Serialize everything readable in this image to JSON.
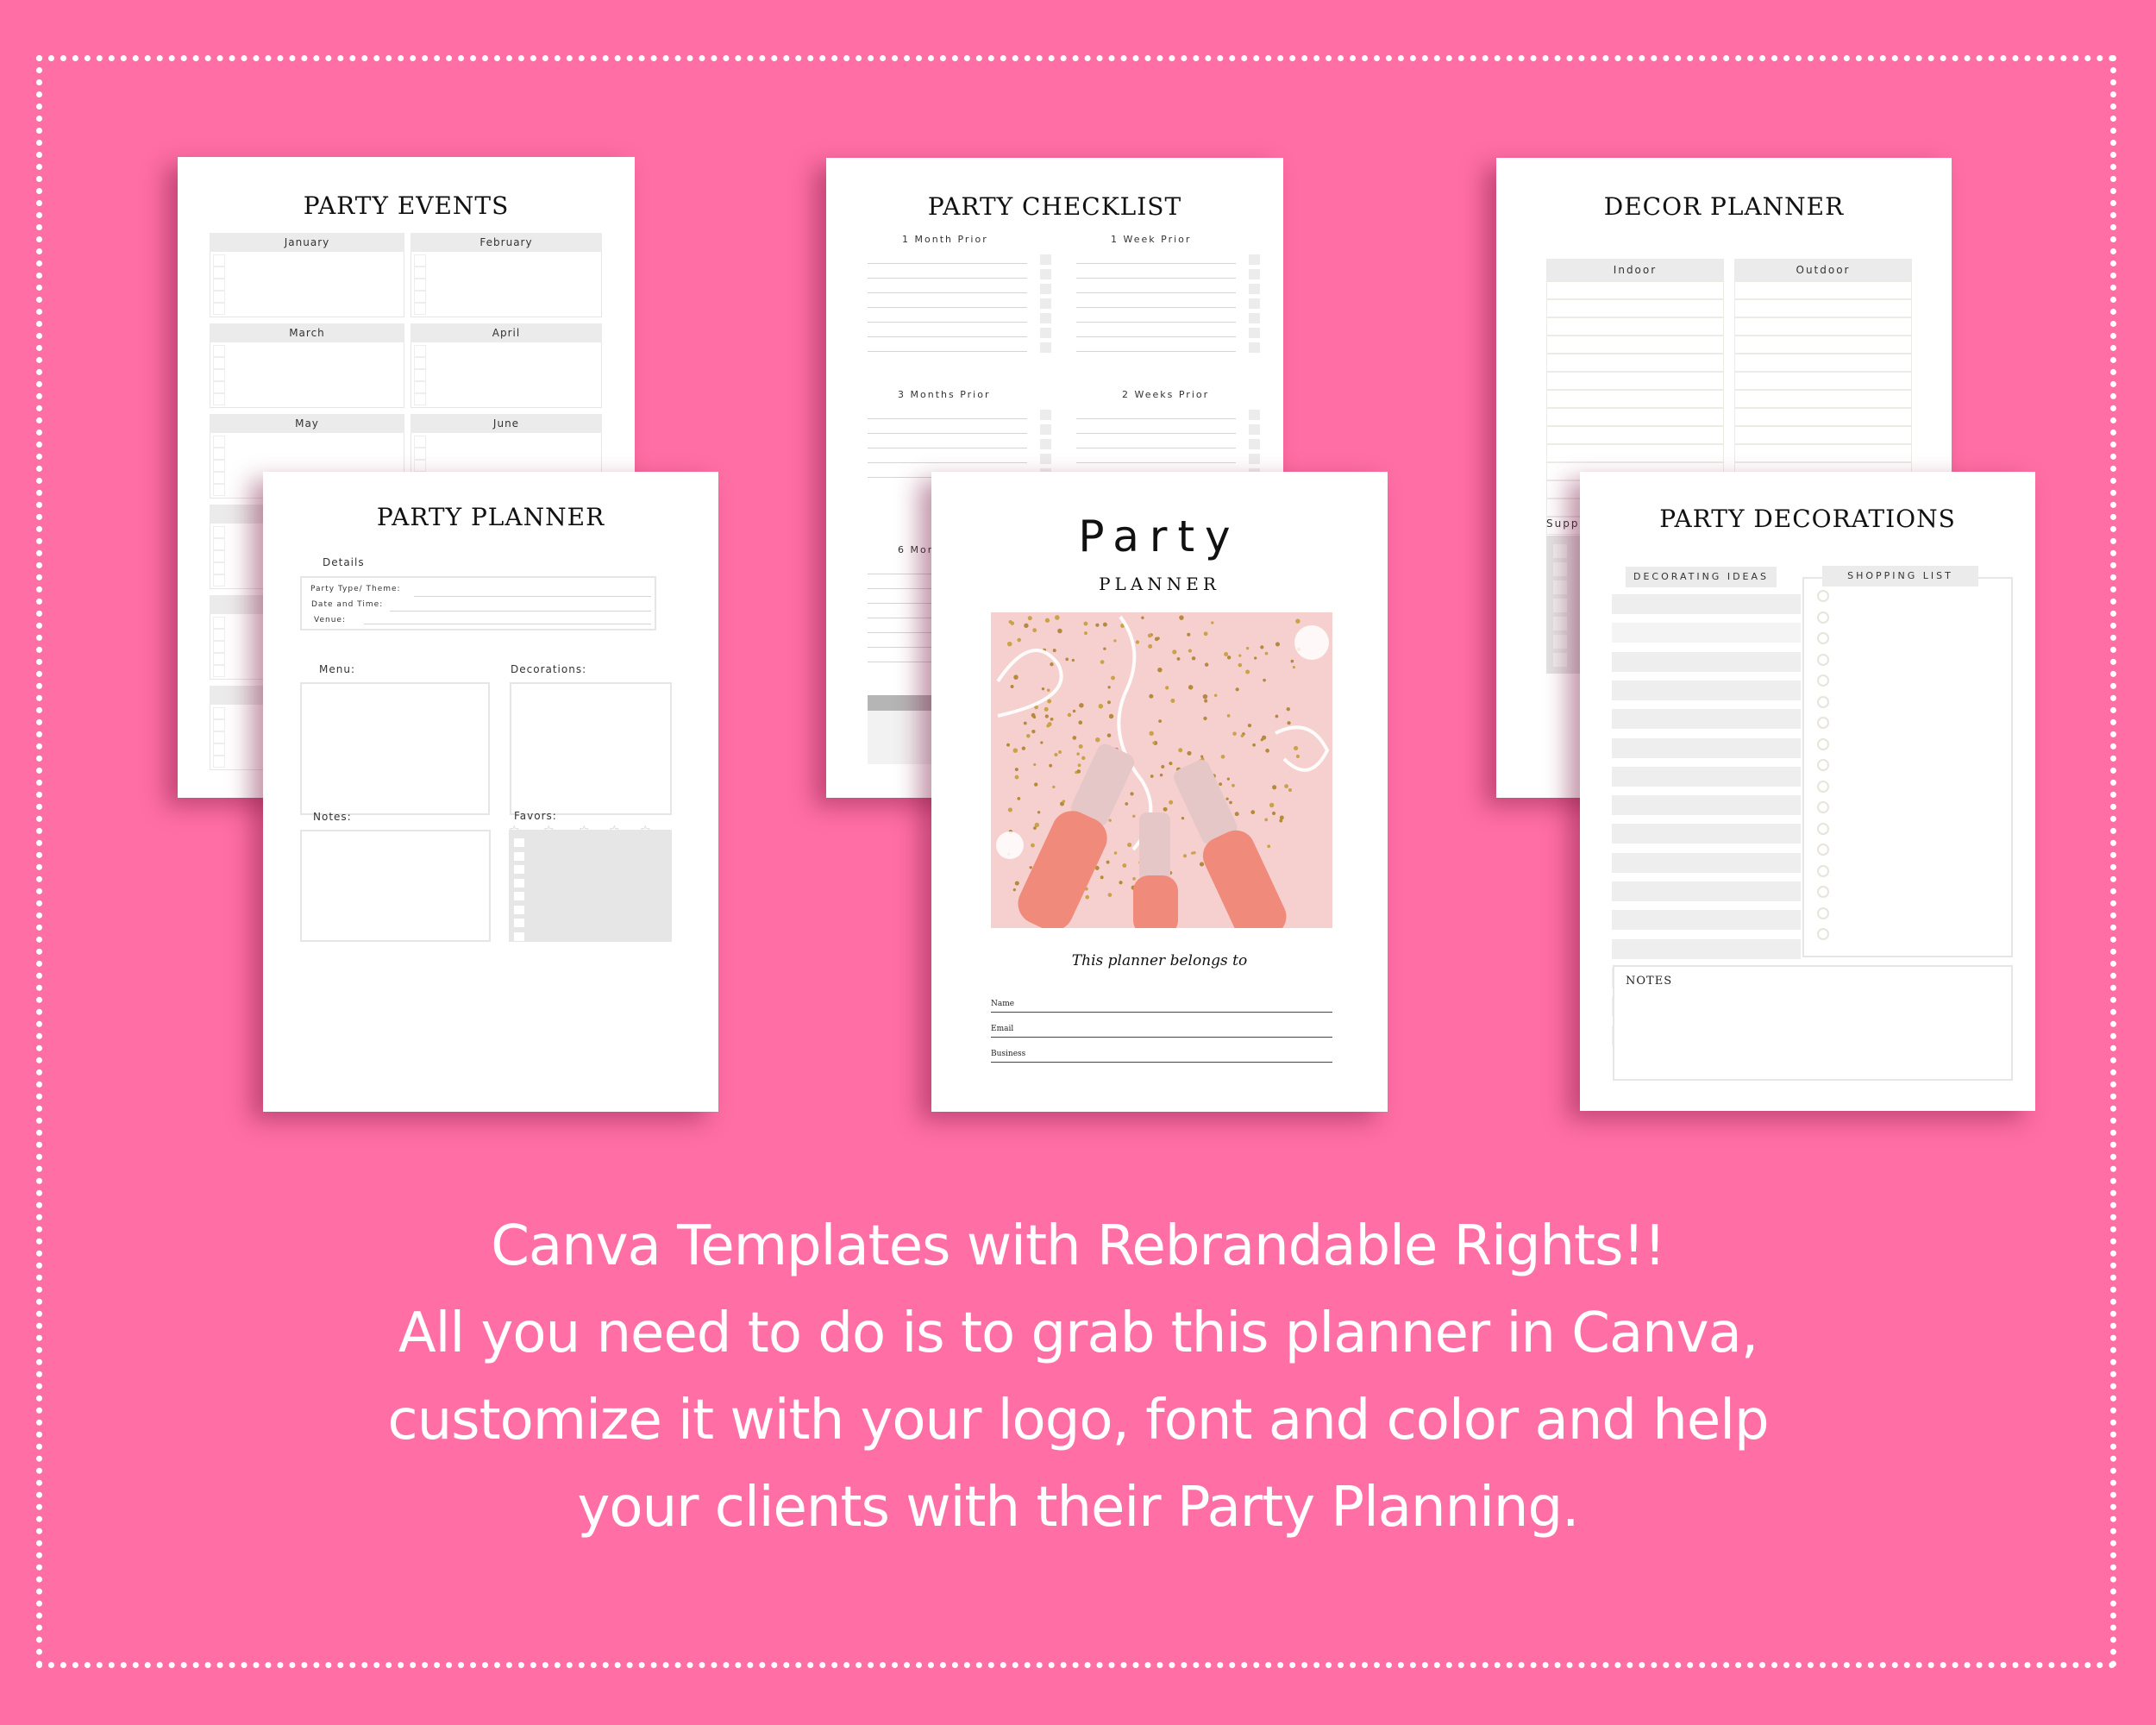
{
  "colors": {
    "background": "#ff6fa5",
    "page": "#ffffff",
    "accent_gray": "#ebebeb"
  },
  "pages": {
    "party_events": {
      "title": "PARTY EVENTS",
      "months": [
        "January",
        "February",
        "March",
        "April",
        "May",
        "June"
      ]
    },
    "party_checklist": {
      "title": "PARTY CHECKLIST",
      "sections": [
        "1 Month Prior",
        "1 Week Prior",
        "3 Months Prior",
        "2 Weeks Prior",
        "6 Mor"
      ]
    },
    "decor_planner": {
      "title": "DECOR PLANNER",
      "columns": [
        "Indoor",
        "Outdoor"
      ],
      "supplies_label": "Supp"
    },
    "party_planner": {
      "title": "PARTY PLANNER",
      "details_label": "Details",
      "fields": [
        "Party Type/ Theme:",
        "Date and Time:",
        "Venue:"
      ],
      "menu_label": "Menu:",
      "decorations_label": "Decorations:",
      "notes_label": "Notes:",
      "favors_label": "Favors:",
      "star_icon": "☆"
    },
    "cover": {
      "title": "Party",
      "subtitle": "PLANNER",
      "image_desc": "rose champagne bottles with gold star confetti on pink",
      "belongs_to": "This planner belongs to",
      "fields": [
        "Name",
        "Email",
        "Business"
      ]
    },
    "party_decorations": {
      "title": "PARTY DECORATIONS",
      "ideas_label": "DECORATING IDEAS",
      "shopping_label": "SHOPPING LIST",
      "notes_label": "NOTES"
    }
  },
  "caption": {
    "line1": "Canva Templates with Rebrandable Rights!!",
    "line2": "All you need to do is to grab this planner in Canva,",
    "line3": "customize it with your logo, font and color and help",
    "line4": "your clients with their Party Planning."
  }
}
